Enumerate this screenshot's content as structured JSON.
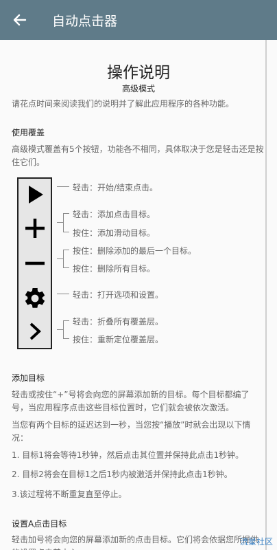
{
  "appbar": {
    "title": "自动点击器"
  },
  "page": {
    "title": "操作说明",
    "subtitle": "高级模式",
    "intro": "请花点时间来阅读我们的说明并了解此应用程序的各种功能。",
    "overlay_heading": "使用覆盖",
    "overlay_text": "高级模式覆盖有5个按钮，功能各不相同，具体取决于您是轻击还是按住它们。",
    "rows": [
      "轻击：开始/结束点击。",
      "轻击：添加点击目标。",
      "按住：添加滑动目标。",
      "按住：删除添加的最后一个目标。",
      "按住：删除所有目标。",
      "轻击：打开选项和设置。",
      "轻击：折叠所有覆盖层。",
      "按住：重新定位覆盖层。"
    ],
    "add_heading": "添加目标",
    "add_text": "轻击或按住“+”号将会向您的屏幕添加新的目标。每个目标都编了号，当应用程序点击这些目标位置时，它们就会被依次激活。",
    "delay_text": "当您有两个目标的延迟达到一秒，当您按“播放”时就会出现以下情况：",
    "step1": "1. 目标1将会等待1秒钟，然后点击其位置并保持此点击1秒钟。",
    "step2": "2. 目标2将会在目标1之后1秒内被激活并保持此点击1秒钟。",
    "step3": "3.该过程将不断重复直至停止。",
    "set_heading": "设置A点击目标",
    "set_text": "轻击加号将会向您的屏幕添加新的点击目标。它们将会依据您所提供的设置点击其中心。"
  },
  "watermark": "流星社区",
  "icons": [
    "back-arrow-icon",
    "play-icon",
    "plus-icon",
    "minus-icon",
    "gear-icon",
    "chevron-right-icon"
  ]
}
